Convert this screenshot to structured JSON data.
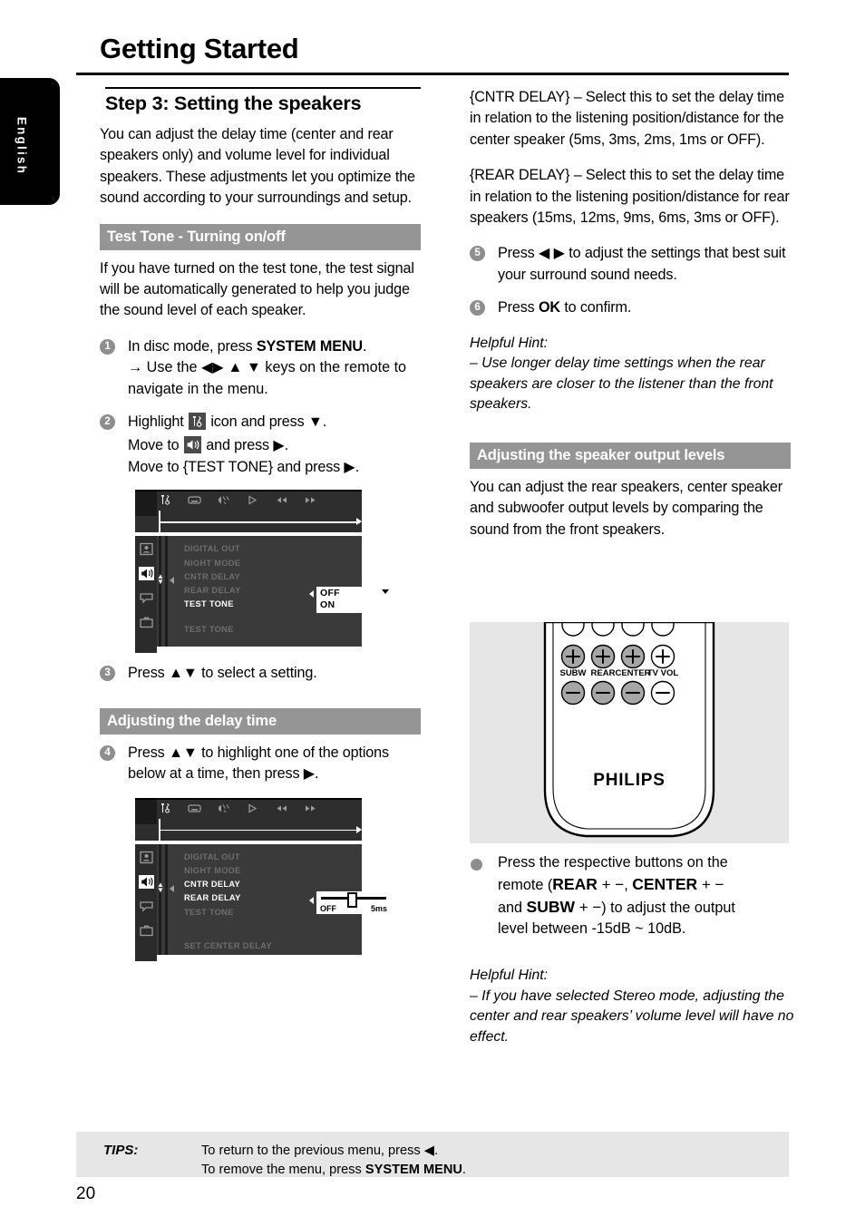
{
  "language_tab": "English",
  "header": {
    "title": "Getting Started"
  },
  "left_column": {
    "step_heading": "Step 3:  Setting the speakers",
    "intro": "You can adjust the delay time (center and rear speakers only) and volume level for individual speakers.  These adjustments let you optimize the sound according to your surroundings and setup.",
    "banner_test_tone": "Test Tone - Turning on/off",
    "test_tone_body": "If you have turned on the test tone, the test signal will be automatically generated to help you judge the sound level of each speaker.",
    "steps": [
      {
        "num": "1",
        "line1_pre": "In disc mode, press ",
        "line1_bold": "SYSTEM MENU",
        "line1_post": ".",
        "line2": "→ Use the ◀▶ ▲ ▼ keys on the remote to navigate in the menu."
      },
      {
        "num": "2",
        "line1_pre": "Highlight ",
        "line1_mid": " icon and press ▼.",
        "line2_pre": "Move to ",
        "line2_post": " and press ▶.",
        "line3": "Move to {TEST TONE} and press ▶."
      },
      {
        "num": "3",
        "text": "Press ▲▼ to select a setting."
      },
      {
        "num": "4",
        "text": "Press ▲▼ to highlight one of the options below at a time, then press ▶."
      }
    ],
    "banner_delay_time": "Adjusting the delay time",
    "tv_menu_1": {
      "toolbar_icons": [
        "tools-icon",
        "display-icon",
        "audio-icon",
        "play-icon",
        "rewind-icon",
        "forward-icon"
      ],
      "sidebar_icons": [
        "disc-icon",
        "speaker-icon",
        "display-icon",
        "preference-icon"
      ],
      "selected_sidebar": "speaker-icon",
      "rows": [
        {
          "label": "DIGITAL OUT",
          "active": false
        },
        {
          "label": "NIGHT MODE",
          "active": false
        },
        {
          "label": "CNTR DELAY",
          "active": false
        },
        {
          "label": "REAR DELAY",
          "active": false
        },
        {
          "label": "TEST TONE",
          "active": true
        }
      ],
      "footer_row": "TEST TONE",
      "options": [
        "OFF",
        "ON"
      ]
    },
    "tv_menu_2": {
      "rows": [
        {
          "label": "DIGITAL OUT",
          "active": false
        },
        {
          "label": "NIGHT MODE",
          "active": false
        },
        {
          "label": "CNTR DELAY",
          "active": true
        },
        {
          "label": "REAR DELAY",
          "active": true
        },
        {
          "label": "TEST TONE",
          "active": false
        }
      ],
      "footer_row": "SET CENTER DELAY",
      "slider": {
        "min_label": "OFF",
        "max_label": "5ms",
        "position_pct": 46
      }
    }
  },
  "right_column": {
    "cntr_delay": "{CNTR DELAY} – Select this to set the delay time in relation to the listening position/distance for the center speaker (5ms, 3ms, 2ms, 1ms or OFF).",
    "rear_delay": "{REAR DELAY} – Select this to set the delay time in relation to the listening position/distance for rear speakers (15ms, 12ms, 9ms, 6ms, 3ms or OFF).",
    "steps": [
      {
        "num": "5",
        "text": "Press ◀ ▶  to adjust the settings that best suit your surround sound needs."
      },
      {
        "num": "6",
        "pre": "Press ",
        "bold": "OK",
        "post": " to confirm."
      }
    ],
    "hint1_label": "Helpful Hint:",
    "hint1_text": "–  Use longer delay time settings when the rear speakers are closer to the listener than the front speakers.",
    "banner_output_levels": "Adjusting the speaker output levels",
    "output_body": "You can adjust the rear speakers, center speaker and subwoofer output levels by comparing the sound from the front speakers.",
    "remote": {
      "buttons": [
        "SUBW",
        "REAR",
        "CENTER",
        "TV VOL"
      ],
      "brand": "PHILIPS"
    },
    "bullet": {
      "l1": "Press the respective buttons on the",
      "l2_pre": "remote (",
      "l2_b1": "REAR",
      "l2_pm1": " + −",
      "l2_mid": ", ",
      "l2_b2": "CENTER",
      "l2_pm2": " + −",
      "l3_pre": "and ",
      "l3_b3": "SUBW",
      "l3_pm3": " + −",
      "l3_post": ") to adjust the output",
      "l4": "level between -15dB ~ 10dB."
    },
    "hint2_label": "Helpful Hint:",
    "hint2_text": "–  If you have selected Stereo mode, adjusting the center and rear speakers’ volume level will have no effect."
  },
  "footer": {
    "tips_label": "TIPS:",
    "tips_line1": "To return to the previous menu, press ◀.",
    "tips_line2_pre": "To remove the menu, press ",
    "tips_line2_bold": "SYSTEM MENU",
    "tips_line2_post": ".",
    "page_number": "20"
  },
  "colors": {
    "banner_gray": "#959595",
    "badge_gray": "#8e8e8e",
    "tips_bg": "#e6e6e6",
    "tv_bg": "#3a3a3a"
  }
}
